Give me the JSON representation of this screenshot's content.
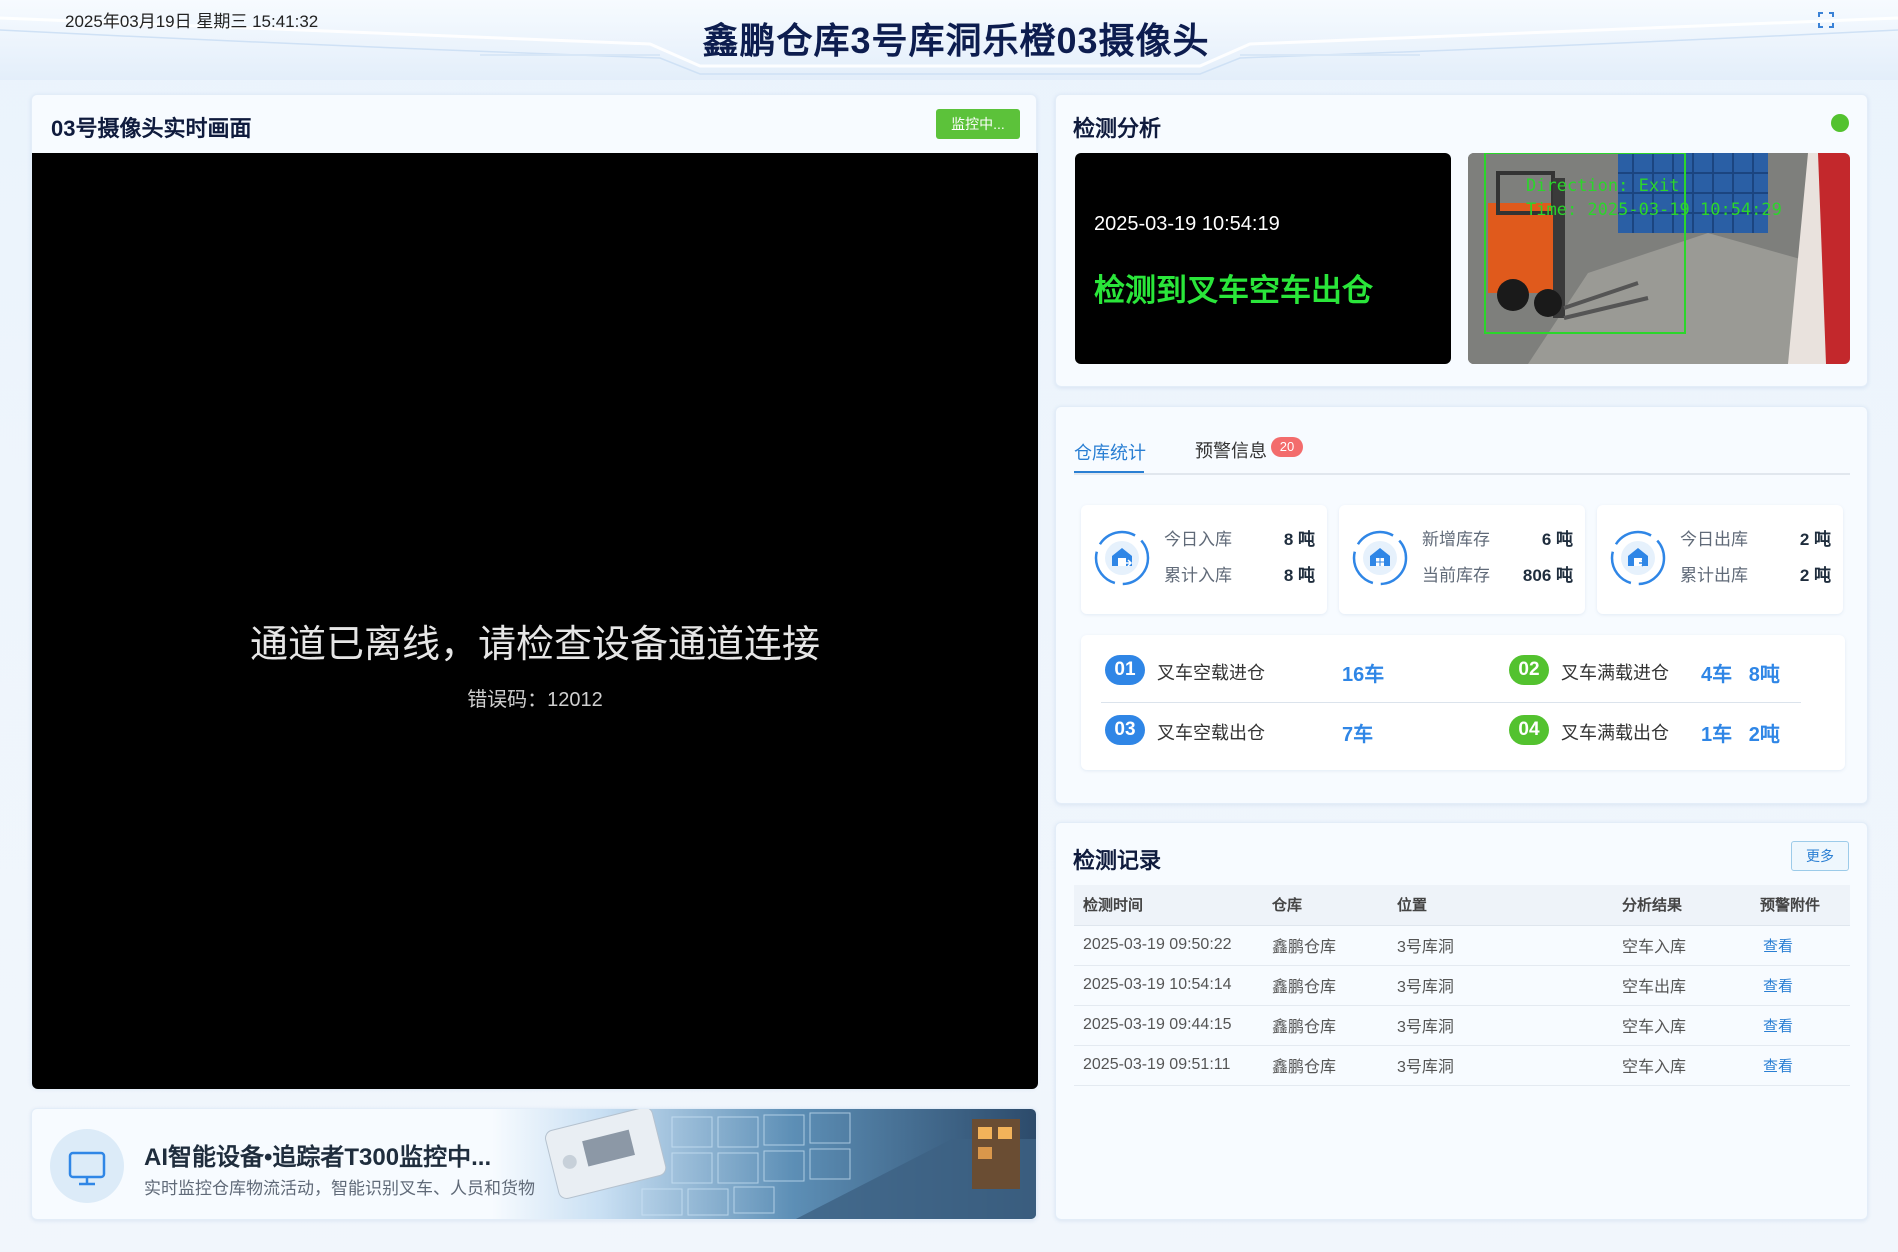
{
  "header": {
    "datetime": "2025年03月19日 星期三 15:41:32",
    "title": "鑫鹏仓库3号库洞乐橙03摄像头"
  },
  "video": {
    "title": "03号摄像头实时画面",
    "status_button": "监控中...",
    "offline_message": "通道已离线，请检查设备通道连接",
    "error_code": "错误码：12012"
  },
  "ai_banner": {
    "title": "AI智能设备•追踪者T300监控中...",
    "subtitle": "实时监控仓库物流活动，智能识别叉车、人员和货物"
  },
  "analysis": {
    "title": "检测分析",
    "event_time": "2025-03-19 10:54:19",
    "event_message": "检测到叉车空车出仓",
    "overlay_line1": "Direction: Exit",
    "overlay_line2": "Time: 2025-03-19 10:54:29",
    "status_color": "#53c22f"
  },
  "stats": {
    "tabs": [
      {
        "label": "仓库统计",
        "active": true
      },
      {
        "label": "预警信息",
        "badge": "20"
      }
    ],
    "cards": [
      {
        "icon": "warehouse-in-icon",
        "rows": [
          {
            "label": "今日入库",
            "value": "8 吨"
          },
          {
            "label": "累计入库",
            "value": "8 吨"
          }
        ]
      },
      {
        "icon": "warehouse-stock-icon",
        "rows": [
          {
            "label": "新增库存",
            "value": "6 吨"
          },
          {
            "label": "当前库存",
            "value": "806 吨"
          }
        ]
      },
      {
        "icon": "warehouse-out-icon",
        "rows": [
          {
            "label": "今日出库",
            "value": "2 吨"
          },
          {
            "label": "累计出库",
            "value": "2 吨"
          }
        ]
      }
    ],
    "forklift": [
      {
        "num": "01",
        "label": "叉车空载进仓",
        "value": "16车",
        "color": "#2f86e6"
      },
      {
        "num": "02",
        "label": "叉车满载进仓",
        "value": "4车   8吨",
        "color": "#53c22f"
      },
      {
        "num": "03",
        "label": "叉车空载出仓",
        "value": "7车",
        "color": "#2f86e6"
      },
      {
        "num": "04",
        "label": "叉车满载出仓",
        "value": "1车   2吨",
        "color": "#53c22f"
      }
    ]
  },
  "records": {
    "title": "检测记录",
    "more_label": "更多",
    "columns": [
      "检测时间",
      "仓库",
      "位置",
      "分析结果",
      "预警附件"
    ],
    "rows": [
      [
        "2025-03-19 09:50:22",
        "鑫鹏仓库",
        "3号库洞",
        "空车入库",
        "查看"
      ],
      [
        "2025-03-19 10:54:14",
        "鑫鹏仓库",
        "3号库洞",
        "空车出库",
        "查看"
      ],
      [
        "2025-03-19 09:44:15",
        "鑫鹏仓库",
        "3号库洞",
        "空车入库",
        "查看"
      ],
      [
        "2025-03-19 09:51:11",
        "鑫鹏仓库",
        "3号库洞",
        "空车入库",
        "查看"
      ]
    ]
  }
}
